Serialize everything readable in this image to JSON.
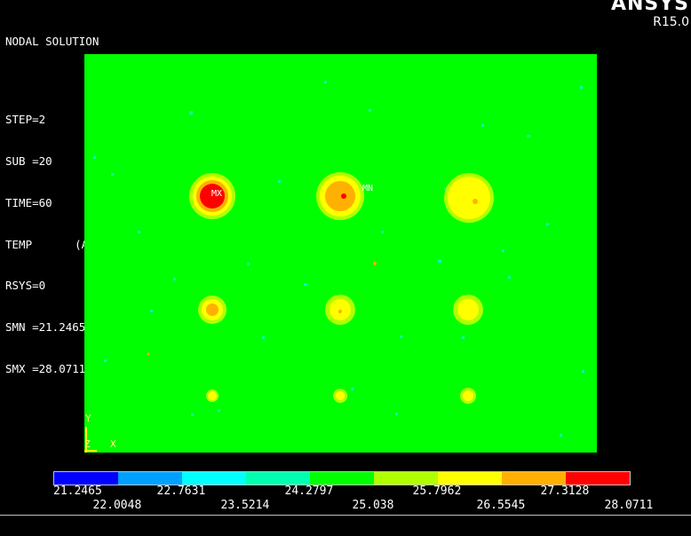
{
  "header": {
    "title": "NODAL SOLUTION",
    "step": "STEP=2",
    "sub": "SUB =20",
    "time": "TIME=60",
    "temp": "TEMP",
    "avg": "(AVG)",
    "rsys": "RSYS=0",
    "smn": "SMN =21.2465",
    "smx": "SMX =28.0711"
  },
  "brand": {
    "name": "ANSYS",
    "version": "R15.0"
  },
  "markers": {
    "mx": "MX",
    "mn": "MN"
  },
  "axes": {
    "y": "Y",
    "z": "Z",
    "x": "X"
  },
  "legend": {
    "colors": [
      "#0000ff",
      "#00a0ff",
      "#00ffff",
      "#00ffb0",
      "#00ff00",
      "#b0ff00",
      "#ffff00",
      "#ffb000",
      "#ff0000"
    ],
    "top_ticks": [
      "21.2465",
      "22.7631",
      "24.2797",
      "25.7962",
      "27.3128"
    ],
    "bottom_ticks": [
      "22.0048",
      "23.5214",
      "25.038",
      "26.5545",
      "28.0711"
    ]
  },
  "colors": {
    "background": "#000000",
    "plot": "#00ff00"
  }
}
